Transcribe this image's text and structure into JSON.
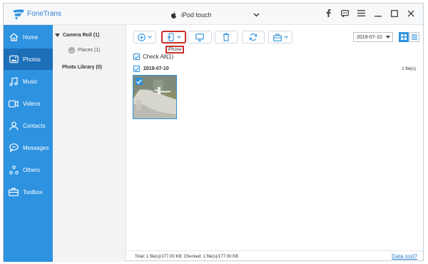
{
  "app": {
    "name": "FoneTrans"
  },
  "device": {
    "name": "iPod touch"
  },
  "sidebar": {
    "items": [
      {
        "label": "Home",
        "icon": "home-icon"
      },
      {
        "label": "Photos",
        "icon": "photo-icon",
        "active": true
      },
      {
        "label": "Music",
        "icon": "music-icon"
      },
      {
        "label": "Videos",
        "icon": "video-icon"
      },
      {
        "label": "Contacts",
        "icon": "contacts-icon"
      },
      {
        "label": "Messages",
        "icon": "messages-icon"
      },
      {
        "label": "Others",
        "icon": "others-icon"
      },
      {
        "label": "Toolbox",
        "icon": "toolbox-icon"
      }
    ]
  },
  "albums": {
    "camera_roll": "Camera Roll (1)",
    "places": "Places (1)",
    "photo_library": "Photo Library (0)"
  },
  "toolbar": {
    "export_tooltip": "iPhone",
    "date_value": "2019-07-10"
  },
  "content": {
    "check_all_label": "Check All(1)",
    "group_date": "2019-07-10",
    "group_count": "1 file(s)"
  },
  "status": {
    "summary": "Total: 1 file(s)/177.00 KB; Checked: 1 file(s)/177.00 KB",
    "data_lost_link": "Data lost?"
  },
  "colors": {
    "accent": "#2d92e0",
    "sidebar_active": "#1d6fb8",
    "highlight": "#c9302c"
  }
}
